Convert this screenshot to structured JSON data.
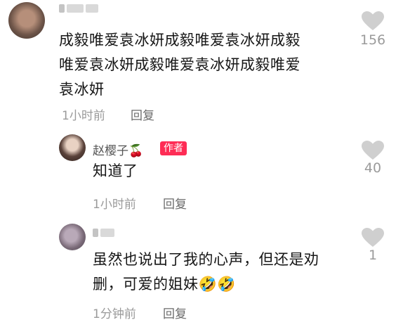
{
  "comments": [
    {
      "text_lines": [
        "成毅唯爱袁冰妍成毅唯爱袁冰妍成毅",
        "唯爱袁冰妍成毅唯爱袁冰妍成毅唯爱",
        "袁冰妍"
      ],
      "time": "1小时前",
      "reply_label": "回复",
      "likes": "156"
    }
  ],
  "replies": [
    {
      "username": "赵樱子🍒",
      "badge": "作者",
      "text_lines": [
        "知道了"
      ],
      "time": "1小时前",
      "reply_label": "回复",
      "likes": "40"
    },
    {
      "text_lines": [
        "虽然也说出了我的心声，但还是劝",
        "删，可爱的姐妹🤣🤣"
      ],
      "time": "1分钟前",
      "reply_label": "回复",
      "likes": "1"
    }
  ]
}
